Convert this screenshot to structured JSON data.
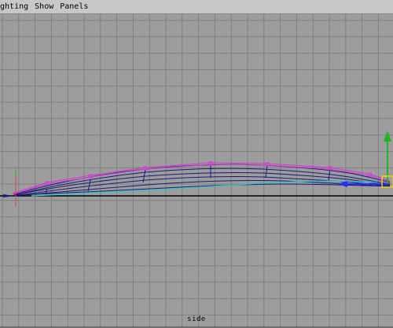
{
  "menubar": {
    "items": [
      "ighting",
      "Show",
      "Panels"
    ]
  },
  "viewport": {
    "label": "side",
    "background_color": "#9d9d9d",
    "grid_color": "#7f7f7f",
    "axis_color": "#000000",
    "wireframe_color": "#1a1a7a",
    "cv_color": "#d23cd2",
    "cyan_curve_color": "#2fc7c7"
  },
  "manipulator": {
    "icon": "move-manipulator-icon",
    "y_axis_color": "#21b621",
    "z_axis_color": "#2c2cff",
    "handle_color": "#f0d200"
  },
  "origin_marker": {
    "icon": "origin-axis-icon"
  }
}
